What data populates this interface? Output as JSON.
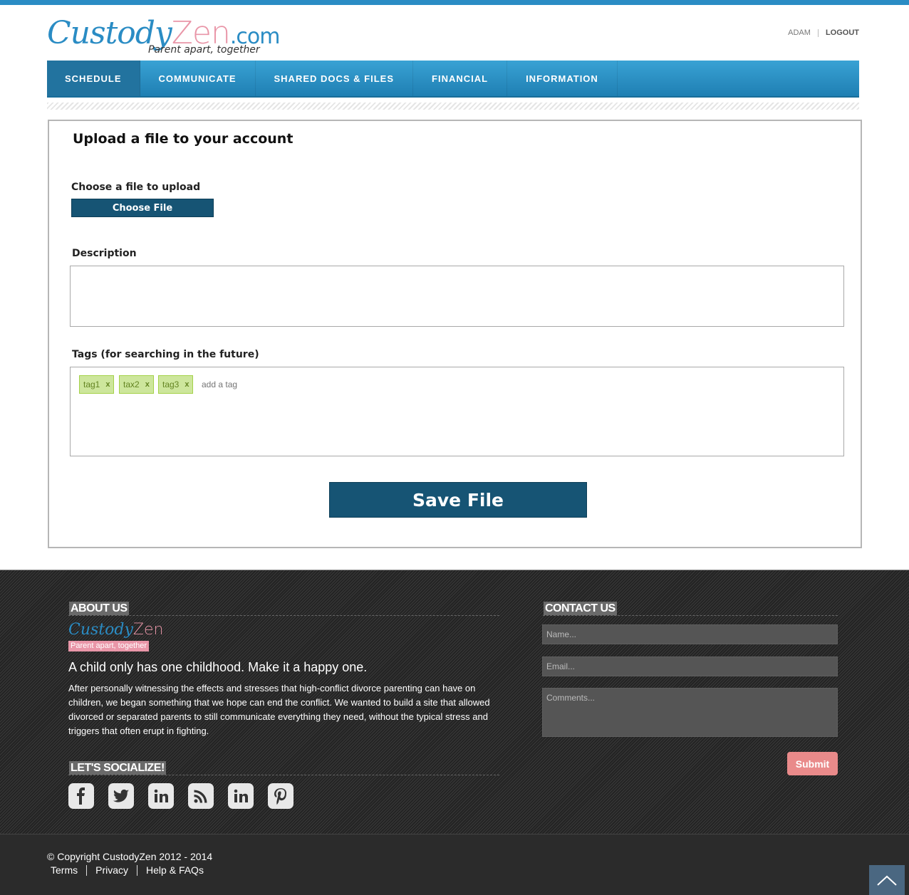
{
  "header": {
    "logo": {
      "custody": "Custody",
      "zen": "Zen",
      "dotcom": ".com",
      "tagline": "Parent apart, together"
    },
    "user": "ADAM",
    "logout": "LOGOUT"
  },
  "nav": {
    "items": [
      {
        "label": "SCHEDULE",
        "active": true
      },
      {
        "label": "COMMUNICATE"
      },
      {
        "label": "SHARED DOCS & FILES"
      },
      {
        "label": "FINANCIAL"
      },
      {
        "label": "INFORMATION"
      }
    ]
  },
  "form": {
    "title": "Upload a file to your account",
    "file_label": "Choose a file to upload",
    "choose_button": "Choose File",
    "description_label": "Description",
    "description_value": "",
    "tags_label": "Tags (for searching in the future)",
    "tags": [
      {
        "label": "tag1",
        "remove": "x"
      },
      {
        "label": "tax2",
        "remove": "x"
      },
      {
        "label": "tag3",
        "remove": "x"
      }
    ],
    "add_tag_placeholder": "add a tag",
    "save_button": "Save File"
  },
  "footer": {
    "about_title": "ABOUT US",
    "mini_logo": {
      "custody": "Custody",
      "zen": "Zen",
      "tagline": "Parent apart, together"
    },
    "motto": "A child only has one childhood. Make it a happy one.",
    "about_text": "After personally witnessing the effects and stresses that high-conflict divorce parenting can have on children, we began something that we hope can end the conflict. We wanted to build a site that allowed divorced or separated parents to still communicate everything they need, without the typical stress and triggers that often erupt in fighting.",
    "social_title": "LET'S SOCIALIZE!",
    "social_icons": [
      "facebook-icon",
      "twitter-icon",
      "linkedin-icon",
      "rss-icon",
      "linkedin-icon",
      "pinterest-icon"
    ],
    "contact_title": "CONTACT US",
    "name_placeholder": "Name...",
    "email_placeholder": "Email...",
    "comments_placeholder": "Comments...",
    "submit": "Submit"
  },
  "bottom": {
    "copyright": "© Copyright CustodyZen 2012 - 2014",
    "links": [
      "Terms",
      "Privacy",
      "Help & FAQs"
    ]
  }
}
